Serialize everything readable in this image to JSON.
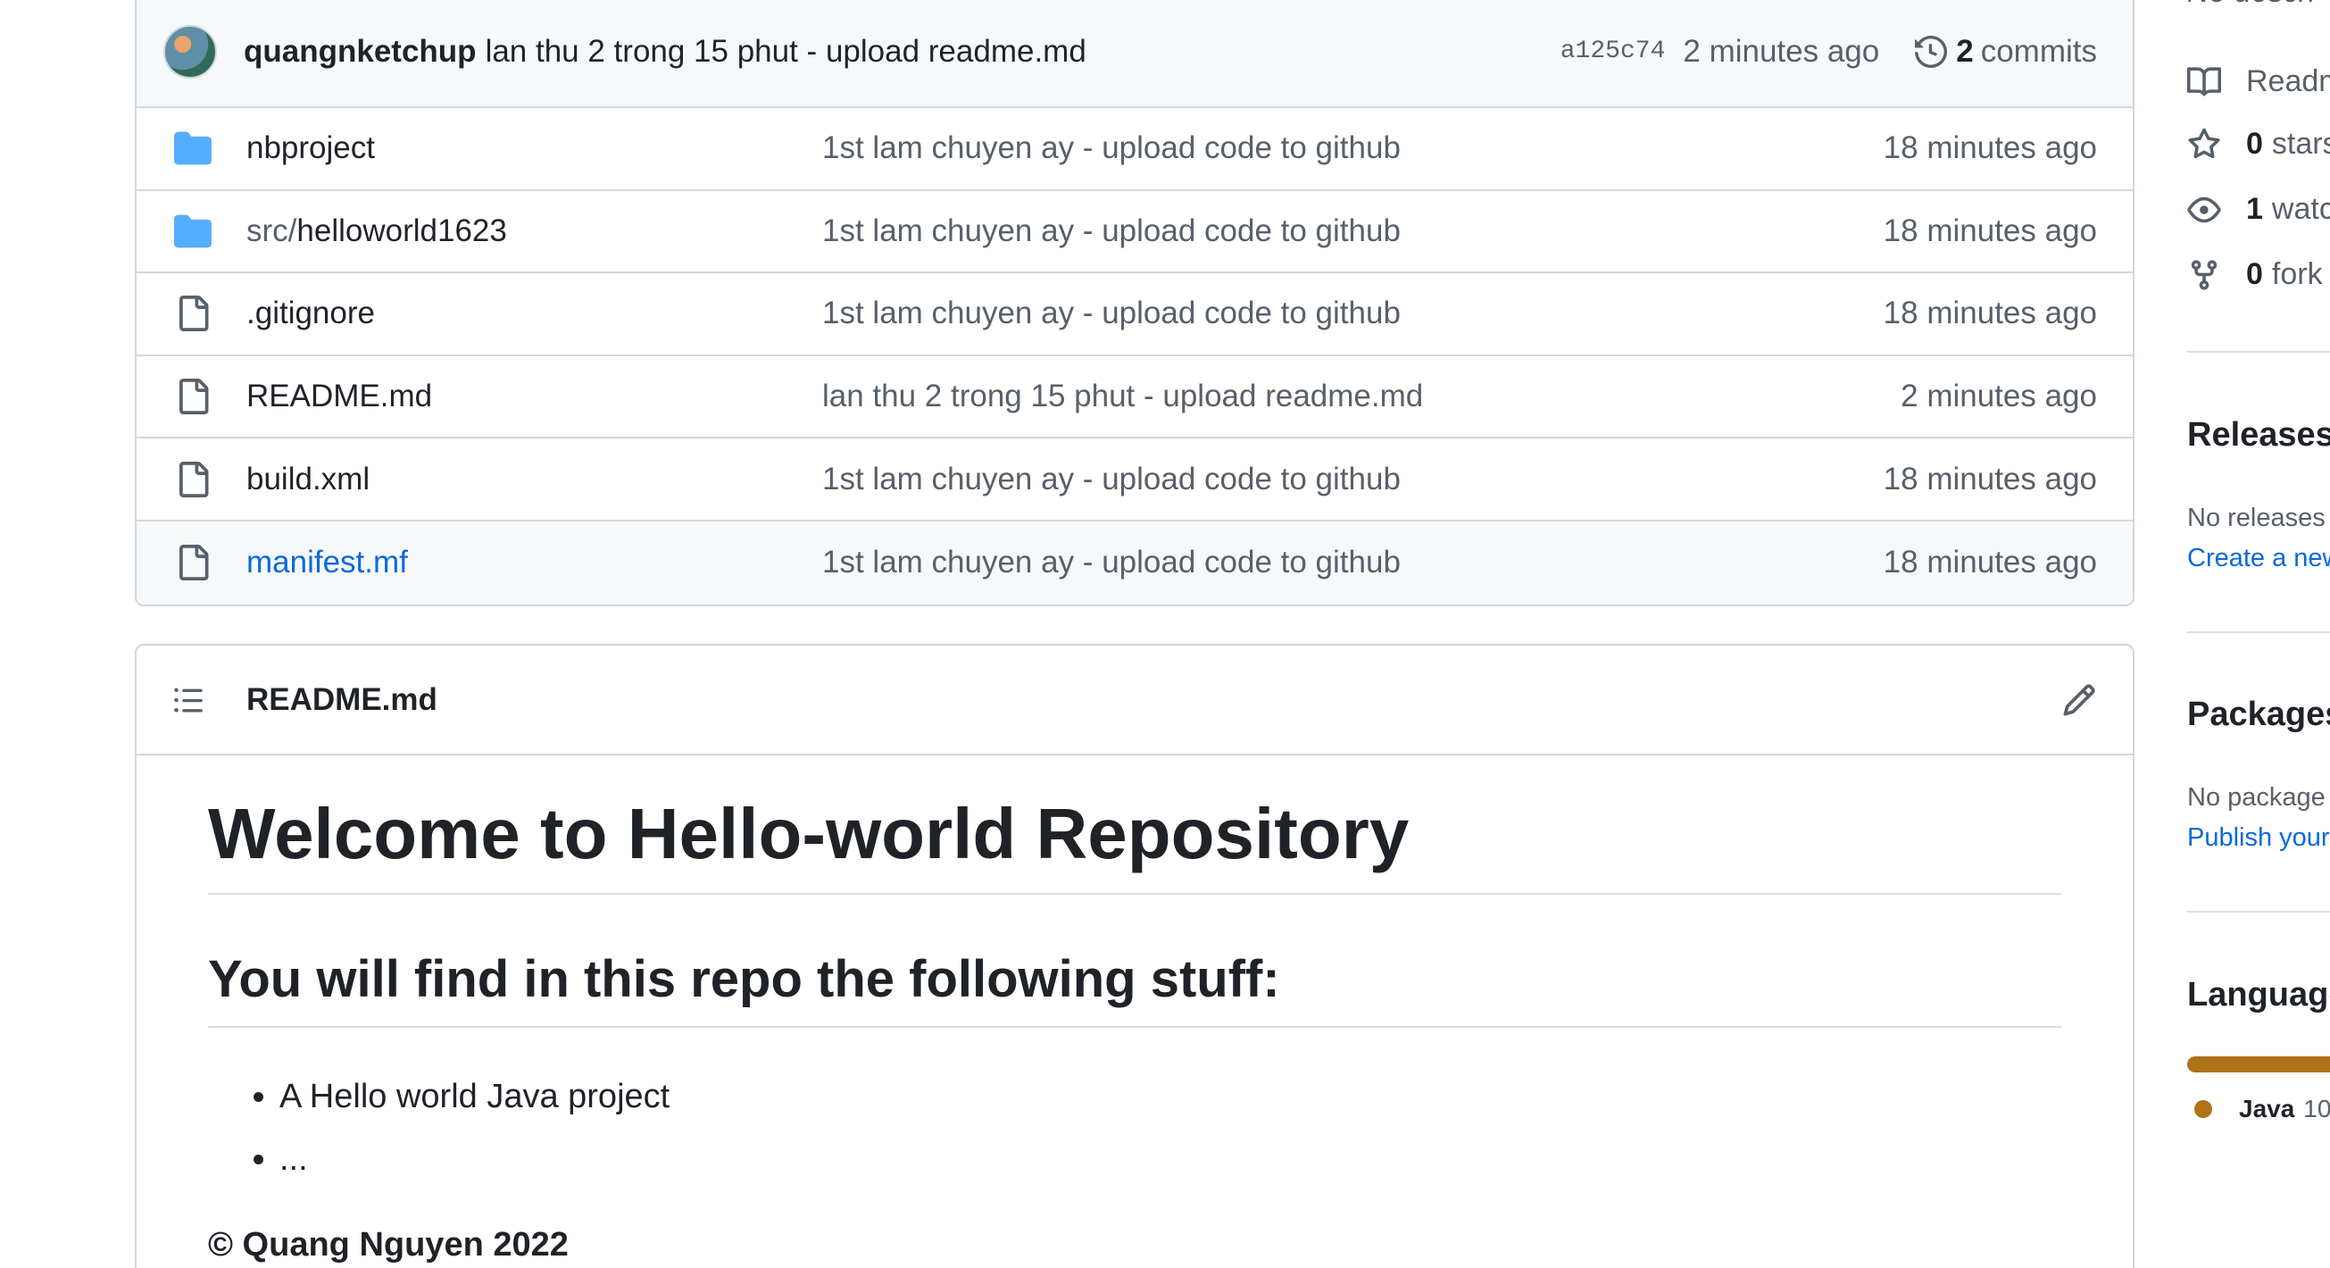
{
  "commit": {
    "author": "quangnketchup",
    "message": "lan thu 2 trong 15 phut - upload readme.md",
    "sha": "a125c74",
    "time": "2 minutes ago",
    "count": "2",
    "count_label": "commits"
  },
  "files": [
    {
      "type": "folder",
      "name_dim": "",
      "name": "nbproject",
      "message": "1st lam chuyen ay - upload code to github",
      "time": "18 minutes ago"
    },
    {
      "type": "folder",
      "name_dim": "src/",
      "name": "helloworld1623",
      "message": "1st lam chuyen ay - upload code to github",
      "time": "18 minutes ago"
    },
    {
      "type": "file",
      "name_dim": "",
      "name": ".gitignore",
      "message": "1st lam chuyen ay - upload code to github",
      "time": "18 minutes ago"
    },
    {
      "type": "file",
      "name_dim": "",
      "name": "README.md",
      "message": "lan thu 2 trong 15 phut - upload readme.md",
      "time": "2 minutes ago"
    },
    {
      "type": "file",
      "name_dim": "",
      "name": "build.xml",
      "message": "1st lam chuyen ay - upload code to github",
      "time": "18 minutes ago"
    },
    {
      "type": "file",
      "name_dim": "",
      "name": "manifest.mf",
      "message": "1st lam chuyen ay - upload code to github",
      "time": "18 minutes ago"
    }
  ],
  "readme": {
    "filename": "README.md",
    "h1": "Welcome to Hello-world Repository",
    "h2": "You will find in this repo the following stuff:",
    "bullets": [
      "A Hello world Java project",
      "..."
    ],
    "copyright": "© Quang Nguyen 2022"
  },
  "sidebar": {
    "description": "No descri",
    "readme": "Readm",
    "stars_count": "0",
    "stars_label": "stars",
    "watchers_count": "1",
    "watchers_label": "watc",
    "forks_count": "0",
    "forks_label": "fork",
    "releases_heading": "Releases",
    "releases_text": "No releases",
    "releases_link": "Create a new",
    "packages_heading": "Packages",
    "packages_text": "No package",
    "packages_link": "Publish your",
    "languages_heading": "Language",
    "language_name": "Java",
    "language_pct": "10",
    "language_color": "#b07219"
  },
  "colors": {
    "link": "#0969da",
    "folder": "#54aeff",
    "muted": "#57606a"
  }
}
